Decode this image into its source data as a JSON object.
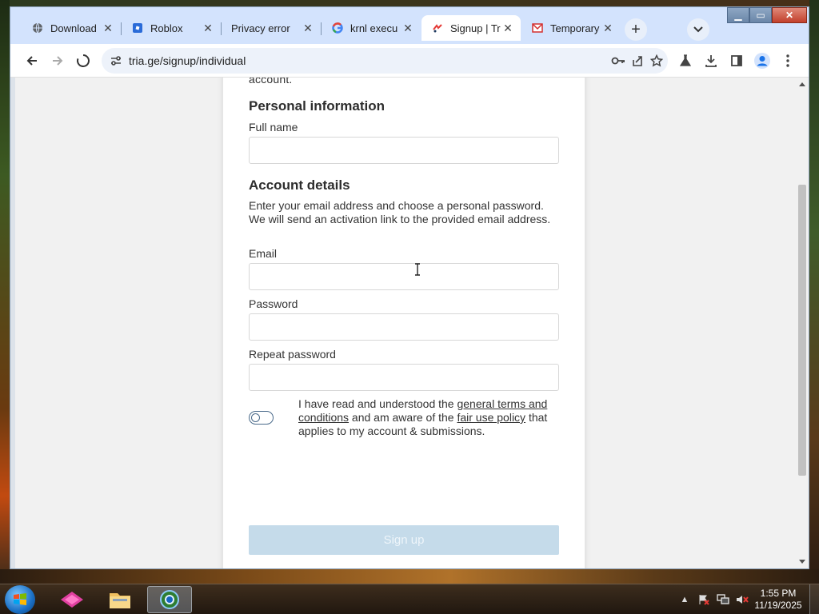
{
  "browser": {
    "tabs": [
      {
        "label": "Download",
        "icon": "globe-icon",
        "active": false
      },
      {
        "label": "Roblox",
        "icon": "roblox-icon",
        "active": false
      },
      {
        "label": "Privacy error",
        "icon": "none",
        "active": false
      },
      {
        "label": "krnl execu",
        "icon": "google-icon",
        "active": false
      },
      {
        "label": "Signup | Tr",
        "icon": "tria-icon",
        "active": true
      },
      {
        "label": "Temporary",
        "icon": "mail-icon",
        "active": false
      }
    ],
    "url": "tria.ge/signup/individual"
  },
  "page": {
    "top_cut_text": "account.",
    "personal_heading": "Personal information",
    "full_name_label": "Full name",
    "full_name_value": "",
    "account_heading": "Account details",
    "account_desc": "Enter your email address and choose a personal password. We will send an activation link to the provided email address.",
    "email_label": "Email",
    "email_value": "",
    "password_label": "Password",
    "password_value": "",
    "repeat_label": "Repeat password",
    "repeat_value": "",
    "terms": {
      "prefix": "I have read and understood the ",
      "link1": "general terms and conditions",
      "middle": " and am aware of the ",
      "link2": "fair use policy",
      "suffix": " that applies to my account & submissions."
    },
    "signup_button": "Sign up"
  },
  "taskbar": {
    "time": "1:55 PM",
    "date": "11/19/2025"
  },
  "colors": {
    "tab_strip": "#d3e3fd",
    "signup_disabled": "#c5dbea",
    "page_bg": "#f1f1f1"
  }
}
